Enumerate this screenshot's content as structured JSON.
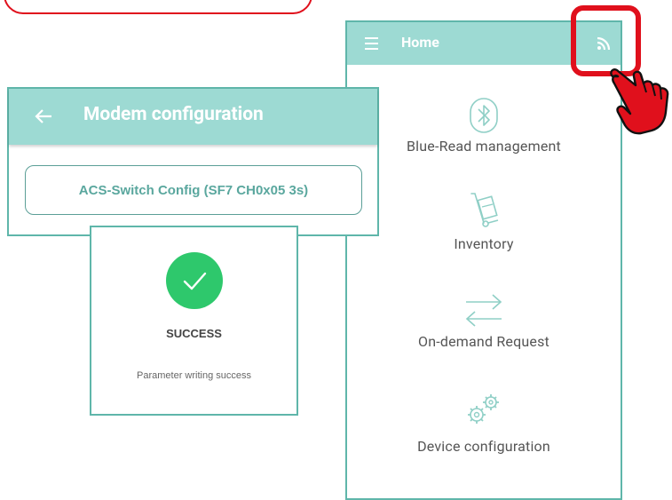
{
  "home": {
    "title": "Home",
    "menu_items": [
      {
        "label": "Blue-Read management",
        "icon": "bluetooth-icon"
      },
      {
        "label": "Inventory",
        "icon": "hand-truck-icon"
      },
      {
        "label": "On-demand Request",
        "icon": "swap-arrows-icon"
      },
      {
        "label": "Device configuration",
        "icon": "gears-icon"
      }
    ]
  },
  "modem": {
    "title": "Modem configuration",
    "config_button": "ACS-Switch Config (SF7 CH0x05 3s)"
  },
  "dialog": {
    "status": "SUCCESS",
    "message": "Parameter writing success"
  },
  "colors": {
    "appbar": "#9ddad3",
    "frame": "#5fb6aa",
    "accent_text": "#5aa79e",
    "success": "#2ec86c",
    "highlight": "#e0101c"
  }
}
